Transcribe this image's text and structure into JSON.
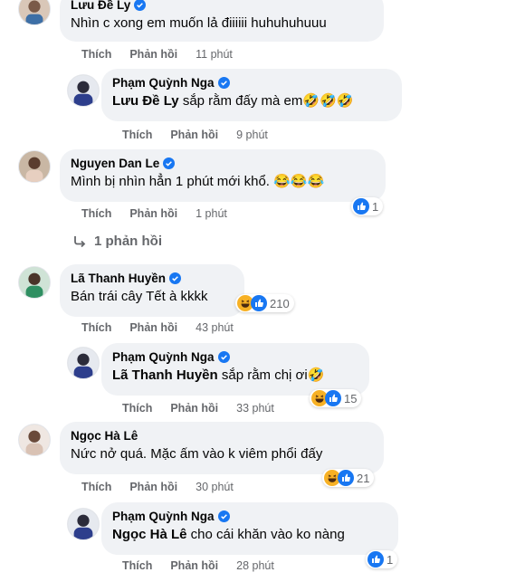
{
  "comments": [
    {
      "name": "Lưu Đề Ly",
      "text": "Nhìn c xong em muốn lả điiiiii huhuhuhuuu",
      "like": "Thích",
      "reply": "Phản hồi",
      "time": "11 phút"
    },
    {
      "name": "Phạm Quỳnh Nga",
      "mention": "Lưu Đề Ly",
      "text": " sắp rằm đấy mà em🤣🤣🤣",
      "like": "Thích",
      "reply": "Phản hồi",
      "time": "9 phút"
    },
    {
      "name": "Nguyen Dan Le",
      "text": "Mình bị nhìn hẳn 1 phút mới khổ. 😂😂😂",
      "like": "Thích",
      "reply": "Phản hồi",
      "time": "1 phút",
      "reaction_count": "1"
    },
    {
      "name": "Lã Thanh Huyền",
      "text": "Bán trái cây Tết à kkkk",
      "like": "Thích",
      "reply": "Phản hồi",
      "time": "43 phút",
      "reaction_count": "210"
    },
    {
      "name": "Phạm Quỳnh Nga",
      "mention": "Lã Thanh Huyền",
      "text": " sắp rằm chị ơi🤣",
      "like": "Thích",
      "reply": "Phản hồi",
      "time": "33 phút",
      "reaction_count": "15"
    },
    {
      "name": "Ngọc Hà Lê",
      "text": "Nức nở quá. Mặc ấm vào k viêm phổi đấy",
      "like": "Thích",
      "reply": "Phản hồi",
      "time": "30 phút",
      "reaction_count": "21"
    },
    {
      "name": "Phạm Quỳnh Nga",
      "mention": "Ngọc Hà Lê",
      "text": " cho cái khăn vào ko nàng",
      "like": "Thích",
      "reply": "Phản hồi",
      "time": "28 phút",
      "reaction_count": "1"
    }
  ],
  "view_replies": "1 phản hồi",
  "colors": {
    "bubble": "#f0f2f5",
    "meta": "#65676b",
    "verified": "#1877f2",
    "like_blue": "#1877f2",
    "haha_yellow": "#f7b125"
  }
}
